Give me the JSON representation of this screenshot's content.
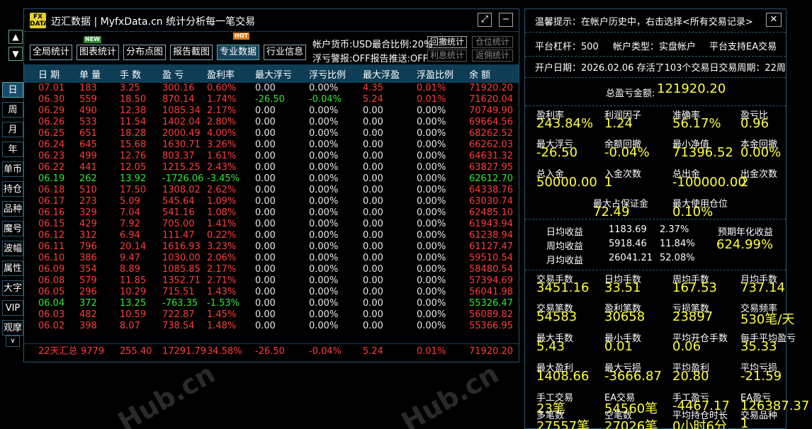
{
  "window": {
    "title": "迈汇数据 | MyfxData.cn  统计分析每一笔交易",
    "logo_top": "FX",
    "logo_bottom": "DATA",
    "minimize_label": "−",
    "restore_label": "⤢"
  },
  "toolbar": {
    "buttons": [
      "全局统计",
      "图表统计",
      "分布点图",
      "报告截图",
      "专业数据",
      "行业信息"
    ],
    "new_badge": "NEW",
    "hot_badge": "HOT",
    "currency_text": "帐户货币:USD最合比例:20%",
    "alert_text": "浮亏警报:OFF报告推送:OFF",
    "small_buttons": [
      "回撤统计",
      "仓位统计",
      "利息统计",
      "返佣统计"
    ]
  },
  "side": {
    "up": "▲",
    "down": "▼",
    "nav": [
      "日",
      "周",
      "月",
      "年",
      "单币",
      "持仓",
      "品种",
      "魔号",
      "波幅",
      "属性",
      "大字",
      "VIP",
      "观摩"
    ],
    "expand": "∨"
  },
  "table": {
    "headers": [
      "日 期",
      "单 量",
      "手 数",
      "盈 亏",
      "盈利率",
      "最大浮亏",
      "浮亏比例",
      "最大浮盈",
      "浮盈比例",
      "余 额"
    ],
    "rows": [
      [
        "07.01",
        "183",
        "3.25",
        "300.16",
        "0.60%",
        "0.00",
        "0.00%",
        "4.35",
        "0.01%",
        "71920.20"
      ],
      [
        "06.30",
        "559",
        "18.50",
        "870.14",
        "1.74%",
        "-26.50",
        "-0.04%",
        "5.24",
        "0.01%",
        "71620.04"
      ],
      [
        "06.29",
        "490",
        "12.38",
        "1085.34",
        "2.17%",
        "0.00",
        "0.00%",
        "0.00",
        "0.00%",
        "70749.90"
      ],
      [
        "06.26",
        "533",
        "11.54",
        "1402.04",
        "2.80%",
        "0.00",
        "0.00%",
        "0.00",
        "0.00%",
        "69664.56"
      ],
      [
        "06.25",
        "651",
        "18.28",
        "2000.49",
        "4.00%",
        "0.00",
        "0.00%",
        "0.00",
        "0.00%",
        "68262.52"
      ],
      [
        "06.24",
        "645",
        "15.68",
        "1630.71",
        "3.26%",
        "0.00",
        "0.00%",
        "0.00",
        "0.00%",
        "66262.03"
      ],
      [
        "06.23",
        "499",
        "12.76",
        "803.37",
        "1.61%",
        "0.00",
        "0.00%",
        "0.00",
        "0.00%",
        "64631.32"
      ],
      [
        "06.22",
        "441",
        "12.05",
        "1215.25",
        "2.43%",
        "0.00",
        "0.00%",
        "0.00",
        "0.00%",
        "63827.95"
      ],
      [
        "06.19",
        "262",
        "13.92",
        "-1726.06",
        "-3.45%",
        "0.00",
        "0.00%",
        "0.00",
        "0.00%",
        "62612.70"
      ],
      [
        "06.18",
        "510",
        "17.50",
        "1308.02",
        "2.62%",
        "0.00",
        "0.00%",
        "0.00",
        "0.00%",
        "64338.76"
      ],
      [
        "06.17",
        "273",
        "5.09",
        "545.64",
        "1.09%",
        "0.00",
        "0.00%",
        "0.00",
        "0.00%",
        "63030.74"
      ],
      [
        "06.16",
        "329",
        "7.04",
        "541.16",
        "1.08%",
        "0.00",
        "0.00%",
        "0.00",
        "0.00%",
        "62485.10"
      ],
      [
        "06.15",
        "429",
        "7.92",
        "705.00",
        "1.41%",
        "0.00",
        "0.00%",
        "0.00",
        "0.00%",
        "61943.94"
      ],
      [
        "06.12",
        "312",
        "6.94",
        "111.47",
        "0.22%",
        "0.00",
        "0.00%",
        "0.00",
        "0.00%",
        "61238.94"
      ],
      [
        "06.11",
        "796",
        "20.14",
        "1616.93",
        "3.23%",
        "0.00",
        "0.00%",
        "0.00",
        "0.00%",
        "61127.47"
      ],
      [
        "06.10",
        "386",
        "9.47",
        "1030.00",
        "2.06%",
        "0.00",
        "0.00%",
        "0.00",
        "0.00%",
        "59510.54"
      ],
      [
        "06.09",
        "354",
        "8.89",
        "1085.85",
        "2.17%",
        "0.00",
        "0.00%",
        "0.00",
        "0.00%",
        "58480.54"
      ],
      [
        "06.08",
        "579",
        "11.85",
        "1352.71",
        "2.71%",
        "0.00",
        "0.00%",
        "0.00",
        "0.00%",
        "57394.69"
      ],
      [
        "06.05",
        "296",
        "10.29",
        "715.51",
        "1.43%",
        "0.00",
        "0.00%",
        "0.00",
        "0.00%",
        "56041.98"
      ],
      [
        "06.04",
        "372",
        "13.25",
        "-763.35",
        "-1.53%",
        "0.00",
        "0.00%",
        "0.00",
        "0.00%",
        "55326.47"
      ],
      [
        "06.03",
        "482",
        "10.59",
        "722.87",
        "1.45%",
        "0.00",
        "0.00%",
        "0.00",
        "0.00%",
        "56089.82"
      ],
      [
        "06.02",
        "398",
        "8.07",
        "738.54",
        "1.48%",
        "0.00",
        "0.00%",
        "0.00",
        "0.00%",
        "55366.95"
      ]
    ],
    "summary": [
      "22天汇总",
      "9779",
      "255.40",
      "17291.79",
      "34.58%",
      "-26.50",
      "-0.04%",
      "5.24",
      "0.01%",
      "71920.20"
    ]
  },
  "right": {
    "tip": "温馨提示：在帐户历史中，右击选择<所有交易记录>",
    "close": "✕",
    "leverage": "平台杠杆：500",
    "acct_type": "帐户类型：实盘帐户",
    "ea": "平台支持EA交易",
    "open_line": "开户日期：2026.02.06 存活了103个交易日交易周期：22周",
    "total_label": "总盈亏金额:",
    "total_value": "121920.20",
    "g1": [
      [
        "盈利率",
        "243.84%"
      ],
      [
        "利润因子",
        "1.24"
      ],
      [
        "准确率",
        "56.17%"
      ],
      [
        "盈亏比",
        "0.96"
      ]
    ],
    "g2": [
      [
        "最大浮亏",
        "-26.50"
      ],
      [
        "余额回撤",
        "-0.04%"
      ],
      [
        "最小净值",
        "71396.52"
      ],
      [
        "本金回撤",
        "0.00%"
      ]
    ],
    "g3": [
      [
        "总入金",
        "50000.00"
      ],
      [
        "入金次数",
        "1"
      ],
      [
        "总出金",
        "-100000.00"
      ],
      [
        "出金次数",
        "2"
      ]
    ],
    "g4": [
      [
        "最大占保证金",
        "72.49"
      ],
      [
        "最大使用仓位",
        "0.10%"
      ]
    ],
    "daily": [
      "日均收益",
      "1183.69",
      "2.37%"
    ],
    "weekly": [
      "周均收益",
      "5918.46",
      "11.84%"
    ],
    "monthly": [
      "月均收益",
      "26041.21",
      "52.08%"
    ],
    "annual_label": "预期年化收益",
    "annual_value": "624.99%",
    "g5": [
      [
        "交易手数",
        "3451.16"
      ],
      [
        "日均手数",
        "33.51"
      ],
      [
        "周均手数",
        "167.53"
      ],
      [
        "月均手数",
        "737.14"
      ]
    ],
    "g6": [
      [
        "交易笔数",
        "54583"
      ],
      [
        "盈利笔数",
        "30658"
      ],
      [
        "亏损笔数",
        "23897"
      ],
      [
        "交易频率",
        "530笔/天"
      ]
    ],
    "g7": [
      [
        "最大手数",
        "5.43"
      ],
      [
        "最小手数",
        "0.01"
      ],
      [
        "平均开仓手数",
        "0.06"
      ],
      [
        "每手平均盈亏",
        "35.33"
      ]
    ],
    "g8": [
      [
        "最大盈利",
        "1408.66"
      ],
      [
        "最大亏损",
        "-3666.87"
      ],
      [
        "平均盈利",
        "20.80"
      ],
      [
        "平均亏损",
        "-21.59"
      ]
    ],
    "g9": [
      [
        "手工交易",
        "23笔"
      ],
      [
        "EA交易",
        "54560笔"
      ],
      [
        "手工盈亏",
        "-4467.17"
      ],
      [
        "EA盈亏",
        "126387.37"
      ]
    ],
    "g10": [
      [
        "多笔数",
        "27557笔"
      ],
      [
        "空笔数",
        "27026笔"
      ],
      [
        "平均持仓时长",
        "0小时6分"
      ],
      [
        "交易品种",
        "1"
      ]
    ]
  }
}
